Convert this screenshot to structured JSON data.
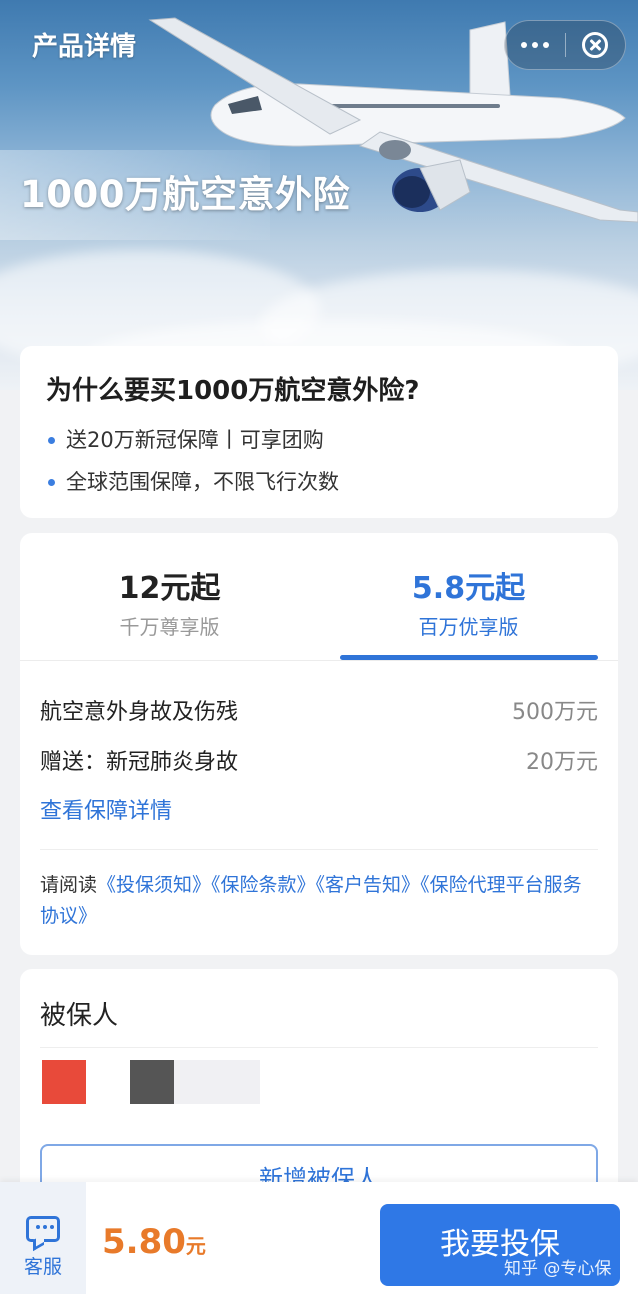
{
  "nav": {
    "title": "产品详情"
  },
  "hero": {
    "title": "1000万航空意外险"
  },
  "why": {
    "heading": "为什么要买1000万航空意外险?",
    "bullets": [
      "送20万新冠保障丨可享团购",
      "全球范围保障，不限飞行次数"
    ]
  },
  "plans": {
    "tabs": [
      {
        "price": "12元起",
        "name": "千万尊享版",
        "active": false
      },
      {
        "price": "5.8元起",
        "name": "百万优享版",
        "active": true
      }
    ],
    "coverage": [
      {
        "item": "航空意外身故及伤残",
        "amount": "500万元"
      },
      {
        "item": "赠送：新冠肺炎身故",
        "amount": "20万元"
      }
    ],
    "detail_link": "查看保障详情",
    "terms_prefix": "请阅读",
    "terms_links": [
      "《投保须知》",
      "《保险条款》",
      "《客户告知》",
      "《保险代理平台服务协议》"
    ]
  },
  "insured": {
    "title": "被保人",
    "add_button": "新增被保人"
  },
  "bottom": {
    "service_label": "客服",
    "price": "5.80",
    "price_unit": "元",
    "buy_button": "我要投保",
    "watermark": "知乎 @专心保"
  },
  "colors": {
    "accent": "#2f74d8",
    "price": "#e87a2a",
    "buy": "#2f78e6"
  }
}
